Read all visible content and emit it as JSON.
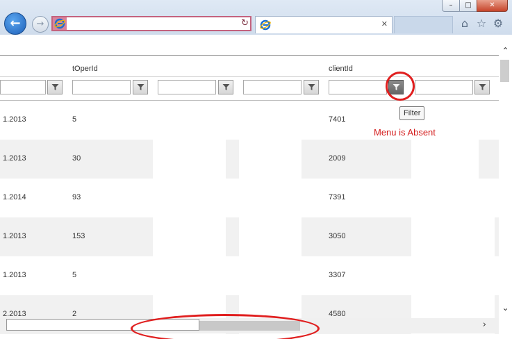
{
  "browser": {
    "window_controls": {
      "minimize": "–",
      "maximize": "□",
      "close": "✕"
    },
    "address_value": "",
    "tab_title": "",
    "tab_close": "✕"
  },
  "grid": {
    "headers": [
      {
        "id": "h-toperid",
        "label": "tOperId"
      },
      {
        "id": "h-clientid",
        "label": "clientId"
      }
    ],
    "rows": [
      {
        "date": "1.2013",
        "toperid": "5",
        "clientid": "7401"
      },
      {
        "date": "1.2013",
        "toperid": "30",
        "clientid": "2009"
      },
      {
        "date": "1.2014",
        "toperid": "93",
        "clientid": "7391"
      },
      {
        "date": "1.2013",
        "toperid": "153",
        "clientid": "3050"
      },
      {
        "date": "1.2013",
        "toperid": "5",
        "clientid": "3307"
      },
      {
        "date": "2.2013",
        "toperid": "2",
        "clientid": "4580"
      }
    ]
  },
  "tooltip": "Filter",
  "annotation": "Menu is Absent",
  "colors": {
    "annotation_red": "#d41c1c",
    "circle_red": "#e01f1f",
    "alt_row": "#f1f1f1"
  },
  "icons": [
    "back-icon",
    "forward-icon",
    "ie-favicon",
    "refresh-icon",
    "home-icon",
    "star-icon",
    "gear-icon",
    "filter-icon",
    "scroll-up-icon",
    "scroll-down-icon",
    "scroll-right-icon"
  ]
}
